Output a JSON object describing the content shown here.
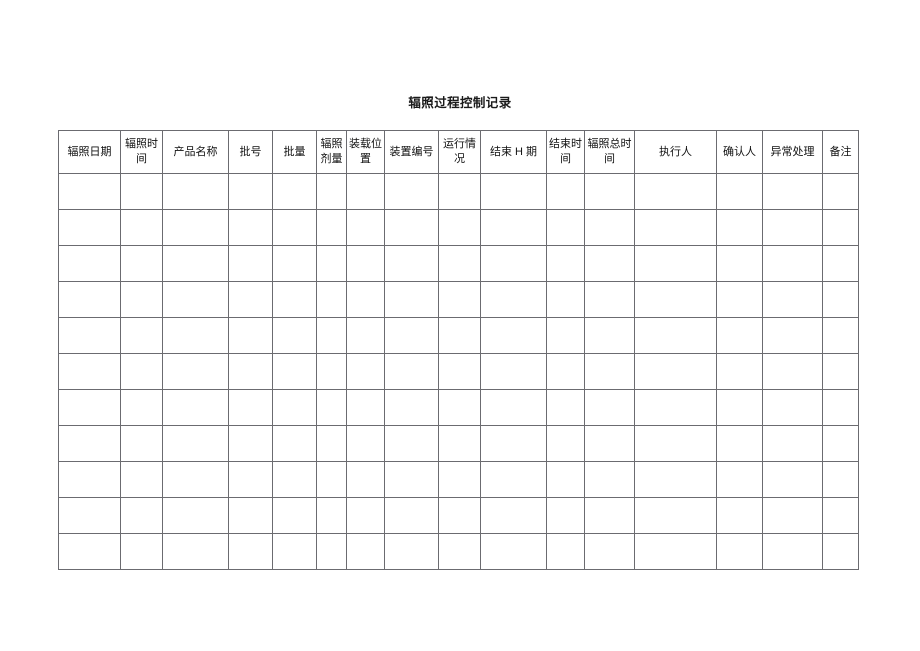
{
  "document": {
    "title": "辐照过程控制记录",
    "background_color": "#ffffff",
    "border_color": "#6b6b70",
    "text_color": "#111111"
  },
  "table": {
    "name": "irradiation-process-control-record-table",
    "column_count": 16,
    "data_row_count": 11,
    "headers": [
      {
        "label": "辐照日期",
        "align": "center",
        "valign": "middle"
      },
      {
        "label": "辐照时间",
        "align": "center",
        "valign": "middle"
      },
      {
        "label": "产品名称",
        "align": "center",
        "valign": "middle"
      },
      {
        "label": "批号",
        "align": "center",
        "valign": "middle"
      },
      {
        "label": "批量",
        "align": "center",
        "valign": "middle"
      },
      {
        "label": "辐照剂量",
        "align": "left",
        "valign": "middle"
      },
      {
        "label": "装载位置",
        "align": "center",
        "valign": "middle"
      },
      {
        "label": "装置编号",
        "align": "center",
        "valign": "bottom"
      },
      {
        "label": "运行情况",
        "align": "center",
        "valign": "middle"
      },
      {
        "label": "结束 H 期",
        "align": "center",
        "valign": "middle"
      },
      {
        "label": "结束时间",
        "align": "center",
        "valign": "middle"
      },
      {
        "label": "辐照总时间",
        "align": "center",
        "valign": "middle"
      },
      {
        "label": "执行人",
        "align": "center",
        "valign": "middle"
      },
      {
        "label": "确认人",
        "align": "center",
        "valign": "bottom"
      },
      {
        "label": "异常处理",
        "align": "center",
        "valign": "bottom"
      },
      {
        "label": "备注",
        "align": "left",
        "valign": "top"
      }
    ],
    "rows": [
      [
        "",
        "",
        "",
        "",
        "",
        "",
        "",
        "",
        "",
        "",
        "",
        "",
        "",
        "",
        "",
        ""
      ],
      [
        "",
        "",
        "",
        "",
        "",
        "",
        "",
        "",
        "",
        "",
        "",
        "",
        "",
        "",
        "",
        ""
      ],
      [
        "",
        "",
        "",
        "",
        "",
        "",
        "",
        "",
        "",
        "",
        "",
        "",
        "",
        "",
        "",
        ""
      ],
      [
        "",
        "",
        "",
        "",
        "",
        "",
        "",
        "",
        "",
        "",
        "",
        "",
        "",
        "",
        "",
        ""
      ],
      [
        "",
        "",
        "",
        "",
        "",
        "",
        "",
        "",
        "",
        "",
        "",
        "",
        "",
        "",
        "",
        ""
      ],
      [
        "",
        "",
        "",
        "",
        "",
        "",
        "",
        "",
        "",
        "",
        "",
        "",
        "",
        "",
        "",
        ""
      ],
      [
        "",
        "",
        "",
        "",
        "",
        "",
        "",
        "",
        "",
        "",
        "",
        "",
        "",
        "",
        "",
        ""
      ],
      [
        "",
        "",
        "",
        "",
        "",
        "",
        "",
        "",
        "",
        "",
        "",
        "",
        "",
        "",
        "",
        ""
      ],
      [
        "",
        "",
        "",
        "",
        "",
        "",
        "",
        "",
        "",
        "",
        "",
        "",
        "",
        "",
        "",
        ""
      ],
      [
        "",
        "",
        "",
        "",
        "",
        "",
        "",
        "",
        "",
        "",
        "",
        "",
        "",
        "",
        "",
        ""
      ],
      [
        "",
        "",
        "",
        "",
        "",
        "",
        "",
        "",
        "",
        "",
        "",
        "",
        "",
        "",
        "",
        ""
      ]
    ]
  }
}
